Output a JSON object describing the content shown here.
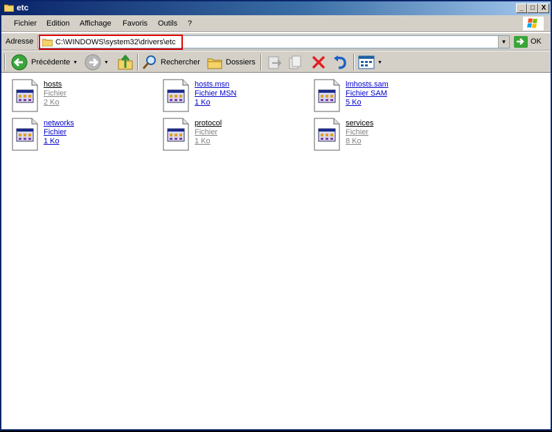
{
  "window": {
    "title": "etc",
    "controls": {
      "minimize": "_",
      "maximize": "□",
      "close": "X"
    }
  },
  "menu": [
    "Fichier",
    "Edition",
    "Affichage",
    "Favoris",
    "Outils",
    "?"
  ],
  "address": {
    "label": "Adresse",
    "value": "C:\\WINDOWS\\system32\\drivers\\etc",
    "go_label": "OK",
    "highlight_color": "#e00000"
  },
  "toolbar": {
    "back_label": "Précédente",
    "search_label": "Rechercher",
    "folders_label": "Dossiers"
  },
  "files": [
    {
      "name": "hosts",
      "type": "Fichier",
      "size": "2 Ko",
      "link": false
    },
    {
      "name": "hosts.msn",
      "type": "Fichier MSN",
      "size": "1 Ko",
      "link": true
    },
    {
      "name": "lmhosts.sam",
      "type": "Fichier SAM",
      "size": "5 Ko",
      "link": true
    },
    {
      "name": "networks",
      "type": "Fichier",
      "size": "1 Ko",
      "link": true
    },
    {
      "name": "protocol",
      "type": "Fichier",
      "size": "1 Ko",
      "link": false
    },
    {
      "name": "services",
      "type": "Fichier",
      "size": "8 Ko",
      "link": false
    }
  ],
  "colors": {
    "titlebar": "#0a246a",
    "chrome": "#d4d0c8",
    "link": "#0000cc"
  }
}
